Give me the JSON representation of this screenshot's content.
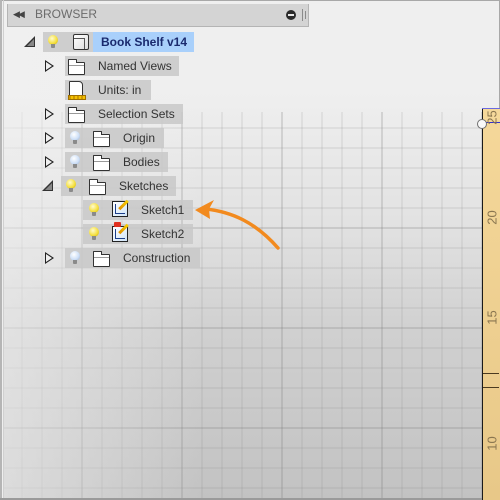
{
  "browser": {
    "title": "BROWSER",
    "collapse_icon": "double-left-arrow-icon",
    "close_icon": "minus-circle-icon"
  },
  "tree": {
    "root": {
      "label": "Book Shelf v14",
      "expanded": true,
      "visible": true,
      "icon": "component-cube-icon",
      "selected": true
    },
    "items": [
      {
        "label": "Named Views",
        "expandable": true,
        "expanded": false,
        "icon": "folder-icon"
      },
      {
        "label": "Units: in",
        "expandable": false,
        "icon": "units-document-icon"
      },
      {
        "label": "Selection Sets",
        "expandable": true,
        "expanded": false,
        "icon": "folder-icon"
      },
      {
        "label": "Origin",
        "expandable": true,
        "expanded": false,
        "visible": false,
        "icon": "folder-icon"
      },
      {
        "label": "Bodies",
        "expandable": true,
        "expanded": false,
        "visible": false,
        "icon": "folder-icon"
      },
      {
        "label": "Sketches",
        "expandable": true,
        "expanded": true,
        "visible": true,
        "icon": "folder-icon",
        "children": [
          {
            "label": "Sketch1",
            "visible": true,
            "icon": "sketch-icon"
          },
          {
            "label": "Sketch2",
            "visible": true,
            "icon": "sketch-pinned-icon"
          }
        ]
      },
      {
        "label": "Construction",
        "expandable": true,
        "expanded": false,
        "visible": false,
        "icon": "folder-icon"
      }
    ]
  },
  "annotation": {
    "type": "arrow",
    "points_to": "Sketch1",
    "color": "#f28a1e"
  },
  "ruler": {
    "labels": [
      "25",
      "20",
      "15",
      "10"
    ]
  },
  "colors": {
    "selection": "#a9d0fb",
    "selected_text": "#1a2a6e",
    "ruler": "#f0d090"
  }
}
